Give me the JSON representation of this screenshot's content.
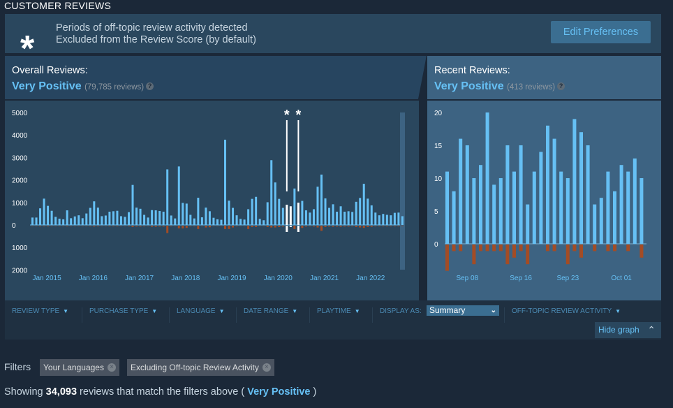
{
  "section_title": "CUSTOMER REVIEWS",
  "banner": {
    "icon": "asterisk-icon",
    "line1": "Periods of off-topic review activity detected",
    "line2": "Excluded from the Review Score (by default)",
    "button": "Edit Preferences"
  },
  "overall": {
    "label": "Overall Reviews:",
    "rating": "Very Positive",
    "count": "(79,785 reviews)",
    "help": "?"
  },
  "recent": {
    "label": "Recent Reviews:",
    "rating": "Very Positive",
    "count": "(413 reviews)",
    "help": "?"
  },
  "colors": {
    "positive": "#66c0f4",
    "negative": "#a34c25",
    "offtopic": "#ffffff",
    "accent": "#66c0f4"
  },
  "chart_data": [
    {
      "type": "bar",
      "title": "",
      "y_tick_labels": [
        "5000",
        "4000",
        "3000",
        "2000",
        "1000",
        "0",
        "1000",
        "2000"
      ],
      "ylim": [
        -2000,
        5000
      ],
      "x_tick_labels": [
        "Jan 2015",
        "Jan 2016",
        "Jan 2017",
        "Jan 2018",
        "Jan 2019",
        "Jan 2020",
        "Jan 2021",
        "Jan 2022"
      ],
      "first_month": "Sep 2014",
      "last_month": "Sep 2022",
      "series": [
        {
          "values": [
            330,
            330,
            740,
            1170,
            850,
            630,
            360,
            280,
            250,
            650,
            300,
            380,
            430,
            300,
            510,
            760,
            1050,
            770,
            390,
            420,
            590,
            610,
            630,
            390,
            360,
            570,
            1780,
            770,
            720,
            450,
            330,
            660,
            650,
            620,
            590,
            2470,
            420,
            290,
            2600,
            980,
            950,
            450,
            290,
            1210,
            340,
            770,
            610,
            320,
            250,
            230,
            3790,
            1080,
            760,
            430,
            270,
            240,
            700,
            1160,
            1250,
            270,
            210,
            1010,
            2880,
            1890,
            1160,
            760,
            900,
            830,
            1620,
            990,
            1070,
            650,
            550,
            700,
            1700,
            2240,
            1180,
            760,
            920,
            590,
            830,
            590,
            610,
            580,
            1030,
            1200,
            1830,
            1170,
            870,
            550,
            430,
            490,
            450,
            430,
            540,
            550,
            390
          ]
        },
        {
          "values": [
            -20,
            -20,
            -30,
            -30,
            -30,
            -20,
            -20,
            -20,
            -20,
            -30,
            -20,
            -20,
            -20,
            -20,
            -20,
            -30,
            -40,
            -30,
            -20,
            -20,
            -30,
            -30,
            -30,
            -20,
            -20,
            -30,
            -60,
            -40,
            -40,
            -30,
            -20,
            -50,
            -50,
            -40,
            -40,
            -330,
            -30,
            -20,
            -120,
            -120,
            -100,
            -30,
            -30,
            -150,
            -20,
            -80,
            -70,
            -20,
            -20,
            -20,
            -150,
            -150,
            -80,
            -30,
            -20,
            -20,
            -150,
            -60,
            -60,
            -20,
            -20,
            -60,
            -80,
            -80,
            -60,
            -40,
            -280,
            -60,
            -150,
            -280,
            -100,
            -40,
            -30,
            -40,
            -80,
            -230,
            -60,
            -40,
            -50,
            -40,
            -50,
            -40,
            -40,
            -30,
            -60,
            -80,
            -100,
            -60,
            -50,
            -30,
            -30,
            -30,
            -30,
            -30,
            -30,
            -30,
            -20
          ]
        }
      ],
      "offtopic_months_index": [
        66,
        67,
        69
      ],
      "offtopic_markers": [
        "*",
        "*"
      ]
    },
    {
      "type": "bar",
      "title": "",
      "y_tick_labels": [
        "20",
        "15",
        "10",
        "5",
        "0"
      ],
      "ylim": [
        -4,
        20
      ],
      "x_tick_labels": [
        "Sep 08",
        "Sep 16",
        "Sep 23",
        "Oct 01"
      ],
      "first_day": "Sep 05",
      "last_day": "Oct 04",
      "series": [
        {
          "values": [
            11,
            8,
            16,
            15,
            10,
            12,
            20,
            9,
            10,
            15,
            11,
            15,
            6,
            11,
            14,
            18,
            16,
            11,
            10,
            19,
            17,
            15,
            6,
            7,
            11,
            8,
            12,
            11,
            13,
            10
          ]
        },
        {
          "values": [
            -4,
            -1,
            -1,
            0,
            -3,
            -1,
            -1,
            -1,
            -1,
            -3,
            -2,
            -1,
            -3,
            0,
            0,
            -1,
            -1,
            0,
            -3,
            -1,
            -2,
            0,
            -1,
            0,
            -1,
            -1,
            0,
            -1,
            0,
            -2
          ]
        }
      ]
    }
  ],
  "filters_bar": {
    "items": [
      "REVIEW TYPE",
      "PURCHASE TYPE",
      "LANGUAGE",
      "DATE RANGE",
      "PLAYTIME",
      "DISPLAY AS:",
      "OFF-TOPIC REVIEW ACTIVITY"
    ],
    "display_as": "Summary",
    "hide_graph": "Hide graph"
  },
  "filters": {
    "label": "Filters",
    "tags": [
      "Your Languages",
      "Excluding Off-topic Review Activity"
    ]
  },
  "summary": {
    "prefix": "Showing",
    "count": "34,093",
    "middle": "reviews that match the filters above (",
    "rating": "Very Positive",
    "suffix": ")"
  }
}
